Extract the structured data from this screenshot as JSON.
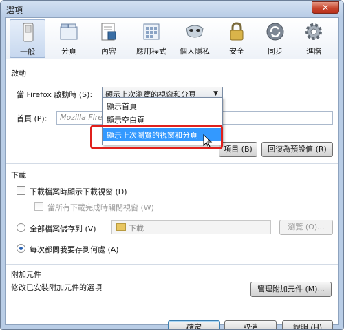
{
  "window": {
    "title": "選項",
    "close_label": "✕"
  },
  "toolbar": {
    "items": [
      {
        "label": "一般",
        "icon": "switch-icon"
      },
      {
        "label": "分頁",
        "icon": "tabs-icon"
      },
      {
        "label": "內容",
        "icon": "content-page-icon"
      },
      {
        "label": "應用程式",
        "icon": "applications-icon"
      },
      {
        "label": "個人隱私",
        "icon": "privacy-mask-icon"
      },
      {
        "label": "安全",
        "icon": "padlock-icon"
      },
      {
        "label": "同步",
        "icon": "sync-icon"
      },
      {
        "label": "進階",
        "icon": "gear-icon"
      }
    ],
    "active_index": 0
  },
  "startup": {
    "section_title": "啟動",
    "when_starts_label": "當 Firefox 啟動時 (S):",
    "selected_option": "顯示上次瀏覽的視窗和分頁",
    "options": [
      "顯示首頁",
      "顯示空白頁",
      "顯示上次瀏覽的視窗和分頁"
    ],
    "home_label": "首頁 (P):",
    "home_placeholder": "Mozilla Firefox...",
    "use_bookmark_button": "項目 (B)",
    "restore_default_button": "回復為預設值 (R)"
  },
  "downloads": {
    "section_title": "下載",
    "show_window_label": "下載檔案時顯示下載視窗 (D)",
    "close_when_done_label": "當所有下載完成時關閉視窗 (W)",
    "save_to_label": "全部檔案儲存到 (V)",
    "folder_value": "下載",
    "browse_button": "瀏覽 (O)...",
    "ask_label": "每次都問我要存到何處 (A)"
  },
  "addons": {
    "section_title": "附加元件",
    "description": "修改已安裝附加元件的選項",
    "manage_button": "管理附加元件 (M)..."
  },
  "footer": {
    "ok_button": "確定",
    "cancel_button": "取消",
    "help_button": "說明 (H)"
  },
  "colors": {
    "selection": "#3399ff",
    "highlight_border": "#e0201c",
    "window_frame": "#b9cde6"
  }
}
